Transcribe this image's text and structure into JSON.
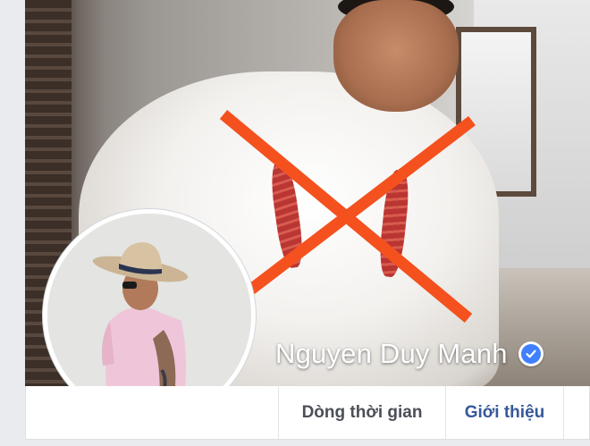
{
  "profile": {
    "name": "Nguyen Duy Manh",
    "verified": true
  },
  "tabs": [
    {
      "label": "Dòng thời gian"
    },
    {
      "label": "Giới thiệu"
    }
  ],
  "colors": {
    "cross_mark": "#f4511e",
    "verified_badge": "#4080ff",
    "link_blue": "#365899",
    "tab_text": "#4b4f56",
    "page_bg": "#e9ebee"
  },
  "icons": {
    "verified": "verified-check-icon",
    "cross": "red-cross-mark"
  }
}
